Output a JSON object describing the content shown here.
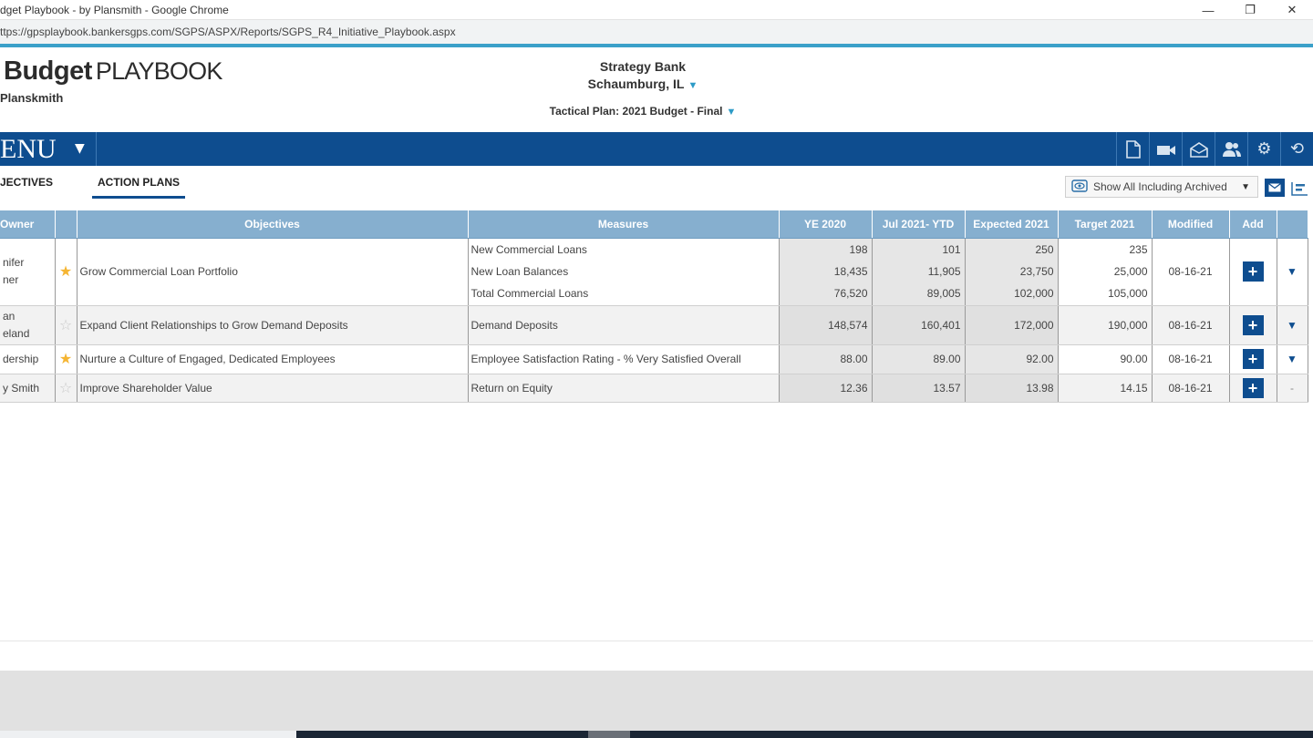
{
  "browser": {
    "title": "dget Playbook - by Plansmith - Google Chrome",
    "url": "ttps://gpsplaybook.bankersgps.com/SGPS/ASPX/Reports/SGPS_R4_Initiative_Playbook.aspx",
    "controls": [
      "—",
      "❐",
      "✕"
    ]
  },
  "header": {
    "logo_bold": "Budget",
    "logo_light": "PLAYBOOK",
    "by_line": "Planskmith",
    "bank_name": "Strategy Bank",
    "bank_city": "Schaumburg, IL",
    "plan": "Tactical Plan: 2021 Budget - Final"
  },
  "menubar": {
    "menu_label": "ENU",
    "menu_caret": "▼",
    "tool_icons": [
      "document-icon",
      "video-icon",
      "mail-open-icon",
      "users-icon",
      "gear-icon",
      "refresh-icon"
    ]
  },
  "tabs": [
    {
      "label": "JECTIVES"
    },
    {
      "label": "ACTION PLANS"
    }
  ],
  "filter": {
    "label": "Show All Including Archived",
    "caret": "▼"
  },
  "table": {
    "columns": [
      "Owner",
      "",
      "Objectives",
      "Measures",
      "YE 2020",
      "Jul 2021- YTD",
      "Expected 2021",
      "Target 2021",
      "Modified",
      "Add",
      ""
    ],
    "rows": [
      {
        "owner_lines": [
          "nifer",
          "ner"
        ],
        "starred": true,
        "objective": "Grow Commercial Loan Portfolio",
        "measures": [
          {
            "name": "New Commercial Loans",
            "ye2020": "198",
            "ytd": "101",
            "expected": "250",
            "target": "235"
          },
          {
            "name": "New Loan Balances",
            "ye2020": "18,435",
            "ytd": "11,905",
            "expected": "23,750",
            "target": "25,000"
          },
          {
            "name": "Total Commercial Loans",
            "ye2020": "76,520",
            "ytd": "89,005",
            "expected": "102,000",
            "target": "105,000"
          }
        ],
        "modified": "08-16-21",
        "expand": "▼"
      },
      {
        "owner_lines": [
          "an",
          "eland"
        ],
        "starred": false,
        "objective": "Expand Client Relationships to Grow Demand Deposits",
        "measures": [
          {
            "name": "Demand Deposits",
            "ye2020": "148,574",
            "ytd": "160,401",
            "expected": "172,000",
            "target": "190,000"
          }
        ],
        "modified": "08-16-21",
        "expand": "▼"
      },
      {
        "owner_lines": [
          "dership"
        ],
        "starred": true,
        "objective": "Nurture a Culture of Engaged, Dedicated Employees",
        "measures": [
          {
            "name": "Employee Satisfaction Rating - % Very Satisfied Overall",
            "ye2020": "88.00",
            "ytd": "89.00",
            "expected": "92.00",
            "target": "90.00"
          }
        ],
        "modified": "08-16-21",
        "expand": "▼"
      },
      {
        "owner_lines": [
          "y Smith"
        ],
        "starred": false,
        "objective": "Improve Shareholder Value",
        "measures": [
          {
            "name": "Return on Equity",
            "ye2020": "12.36",
            "ytd": "13.57",
            "expected": "13.98",
            "target": "14.15"
          }
        ],
        "modified": "08-16-21",
        "expand": "-"
      }
    ]
  }
}
